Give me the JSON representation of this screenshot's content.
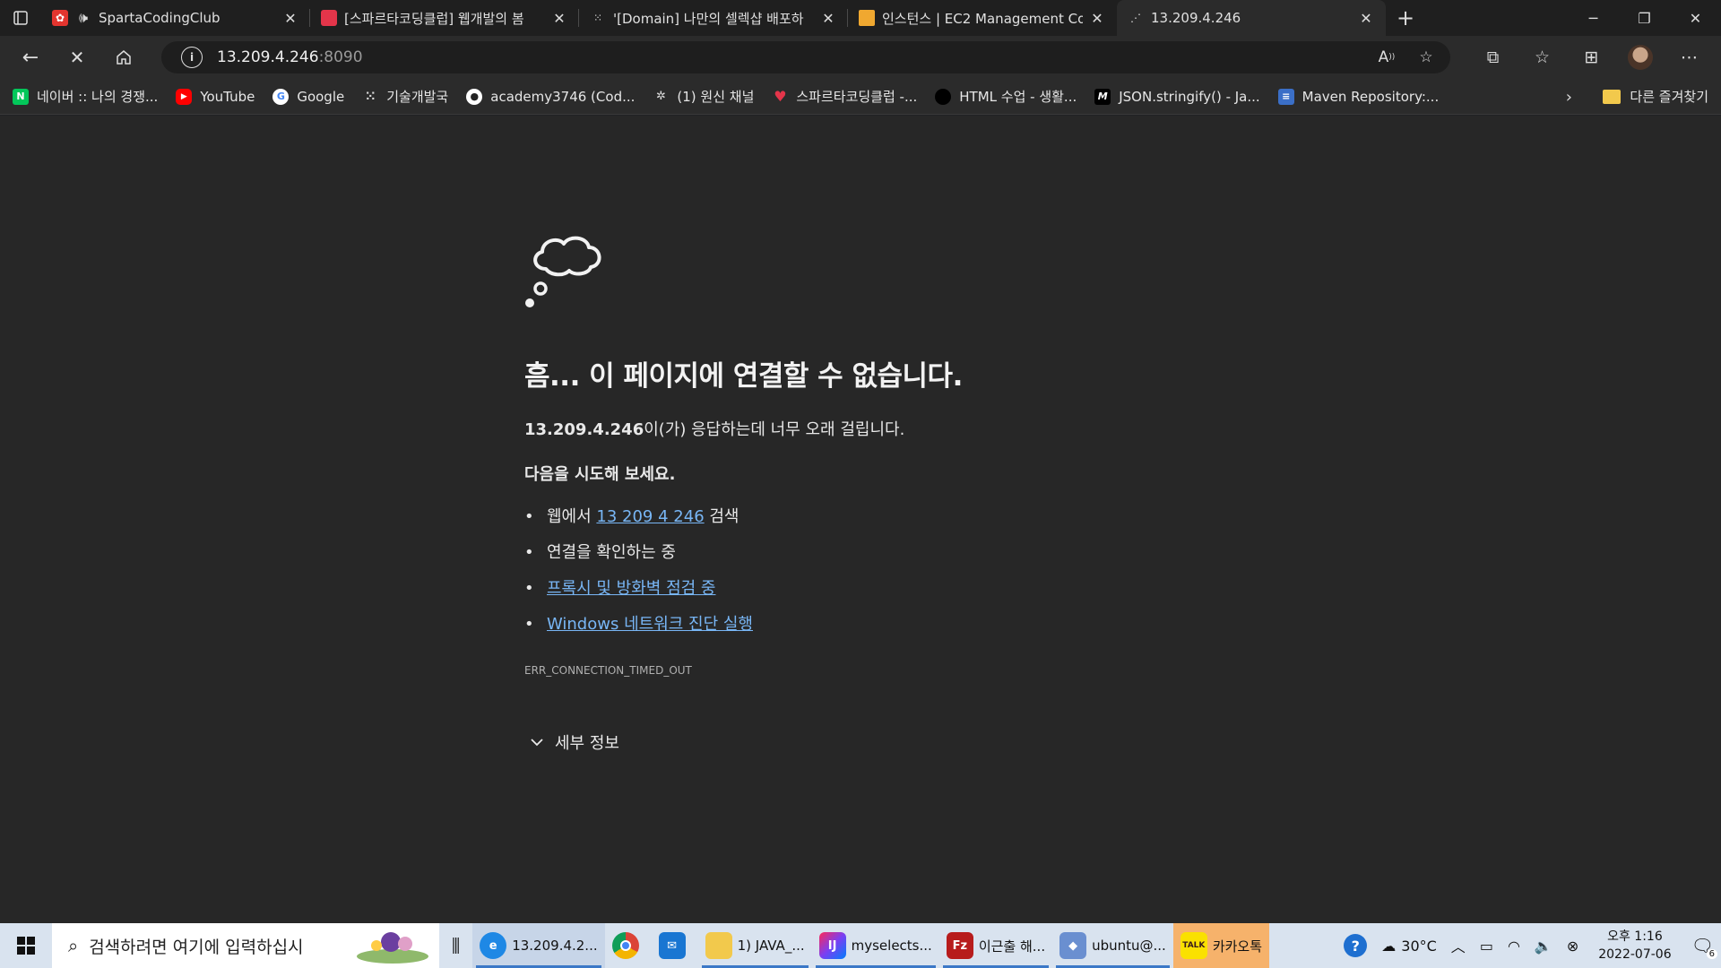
{
  "tabs": [
    {
      "title": "SpartaCodingClub",
      "favicon": "sparta-icon",
      "color": "#e4352f",
      "audio": true
    },
    {
      "title": "[스파르타코딩클럽] 웹개발의 봄",
      "favicon": "book-icon",
      "color": "#e4354a"
    },
    {
      "title": "'[Domain] 나만의 셀렉샵 배포하",
      "favicon": "dots-icon",
      "color": "#dddddd"
    },
    {
      "title": "인스턴스 | EC2 Management Con",
      "favicon": "aws-box-icon",
      "color": "#f0a830"
    },
    {
      "title": "13.209.4.246",
      "favicon": "loading-icon",
      "color": "#dddddd",
      "active": true
    }
  ],
  "address": {
    "host": "13.209.4.246",
    "port": ":8090"
  },
  "bookmarks": [
    {
      "label": "네이버 :: 나의 경쟁...",
      "icon": "naver-icon",
      "color": "#03c75a",
      "glyph": "N"
    },
    {
      "label": "YouTube",
      "icon": "youtube-icon",
      "color": "#ff0000",
      "glyph": "▶"
    },
    {
      "label": "Google",
      "icon": "google-icon",
      "color": "#ffffff",
      "glyph": "G"
    },
    {
      "label": "기술개발국",
      "icon": "dots-icon",
      "color": "#2b2b2b",
      "glyph": "⁙"
    },
    {
      "label": "academy3746 (Cod...",
      "icon": "github-icon",
      "color": "#ffffff",
      "glyph": "●"
    },
    {
      "label": "(1) 원신 채널",
      "icon": "genshin-icon",
      "color": "#2b2b2b",
      "glyph": "✲"
    },
    {
      "label": "스파르타코딩클럽 -...",
      "icon": "sparta-heart-icon",
      "color": "#e4354a",
      "glyph": "♥"
    },
    {
      "label": "HTML 수업 - 생활...",
      "icon": "black-circle-icon",
      "color": "#000000",
      "glyph": ""
    },
    {
      "label": "JSON.stringify() - Ja...",
      "icon": "mdn-icon",
      "color": "#000000",
      "glyph": "M"
    },
    {
      "label": "Maven Repository:...",
      "icon": "maven-icon",
      "color": "#3b6fc7",
      "glyph": "≡"
    }
  ],
  "other_bookmarks": "다른 즐겨찾기",
  "error": {
    "heading": "흠... 이 페이지에 연결할 수 없습니다.",
    "host_bold": "13.209.4.246",
    "message_rest": "이(가) 응답하는데 너무 오래 걸립니다.",
    "try_label": "다음을 시도해 보세요.",
    "suggestion1_prefix": "웹에서 ",
    "suggestion1_link": "13 209 4 246",
    "suggestion1_suffix": " 검색",
    "suggestion2": "연결을 확인하는 중",
    "suggestion3_link": "프록시 및 방화벽 점검 중",
    "suggestion4_link": "Windows 네트워크 진단 실행",
    "code": "ERR_CONNECTION_TIMED_OUT",
    "details": "세부 정보"
  },
  "taskbar": {
    "search_placeholder": "검색하려면 여기에 입력하십시",
    "apps": [
      {
        "label": "13.209.4.2...",
        "icon": "edge-icon",
        "color": "#1e88e5"
      },
      {
        "label": "",
        "icon": "chrome-icon",
        "color": "#db4437"
      },
      {
        "label": "",
        "icon": "mail-icon",
        "color": "#1976d2"
      },
      {
        "label": "1) JAVA_...",
        "icon": "folder-icon",
        "color": "#f2c94c"
      },
      {
        "label": "myselects...",
        "icon": "intellij-icon",
        "color": "#7b3ff2"
      },
      {
        "label": "이근출 해...",
        "icon": "filezilla-icon",
        "color": "#b71c1c"
      },
      {
        "label": "ubuntu@...",
        "icon": "putty-icon",
        "color": "#6a8fd0"
      },
      {
        "label": "카카오톡",
        "icon": "kakaotalk-icon",
        "color": "#3a1d1d"
      }
    ],
    "weather": "30°C",
    "time": "오후 1:16",
    "date": "2022-07-06",
    "notifications": "6"
  }
}
